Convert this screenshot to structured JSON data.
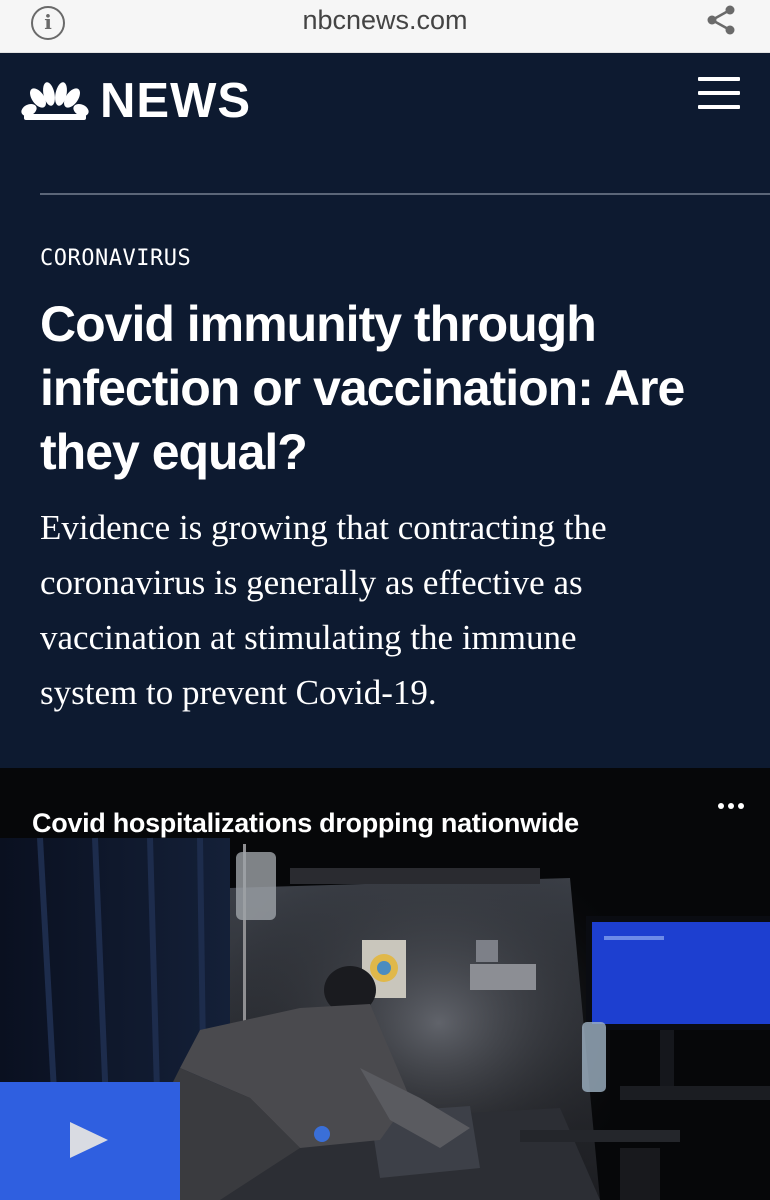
{
  "browser": {
    "domain": "nbcnews.com",
    "info_icon": "info-icon",
    "share_icon": "share-icon"
  },
  "header": {
    "logo_text": "NEWS",
    "logo_icon": "nbc-peacock-icon",
    "menu_icon": "hamburger-menu-icon"
  },
  "article": {
    "category": "CORONAVIRUS",
    "headline": "Covid immunity through infection or vaccination: Are they equal?",
    "dek": "Evidence is growing that contracting the coronavirus is generally as effective as vaccination at stimulating the immune system to prevent Covid-19."
  },
  "video": {
    "title": "Covid hospitalizations dropping nationwide",
    "more_icon": "more-options-icon",
    "play_icon": "play-icon"
  },
  "colors": {
    "page_background": "#0d1a30",
    "play_button": "#2f5fe0"
  }
}
